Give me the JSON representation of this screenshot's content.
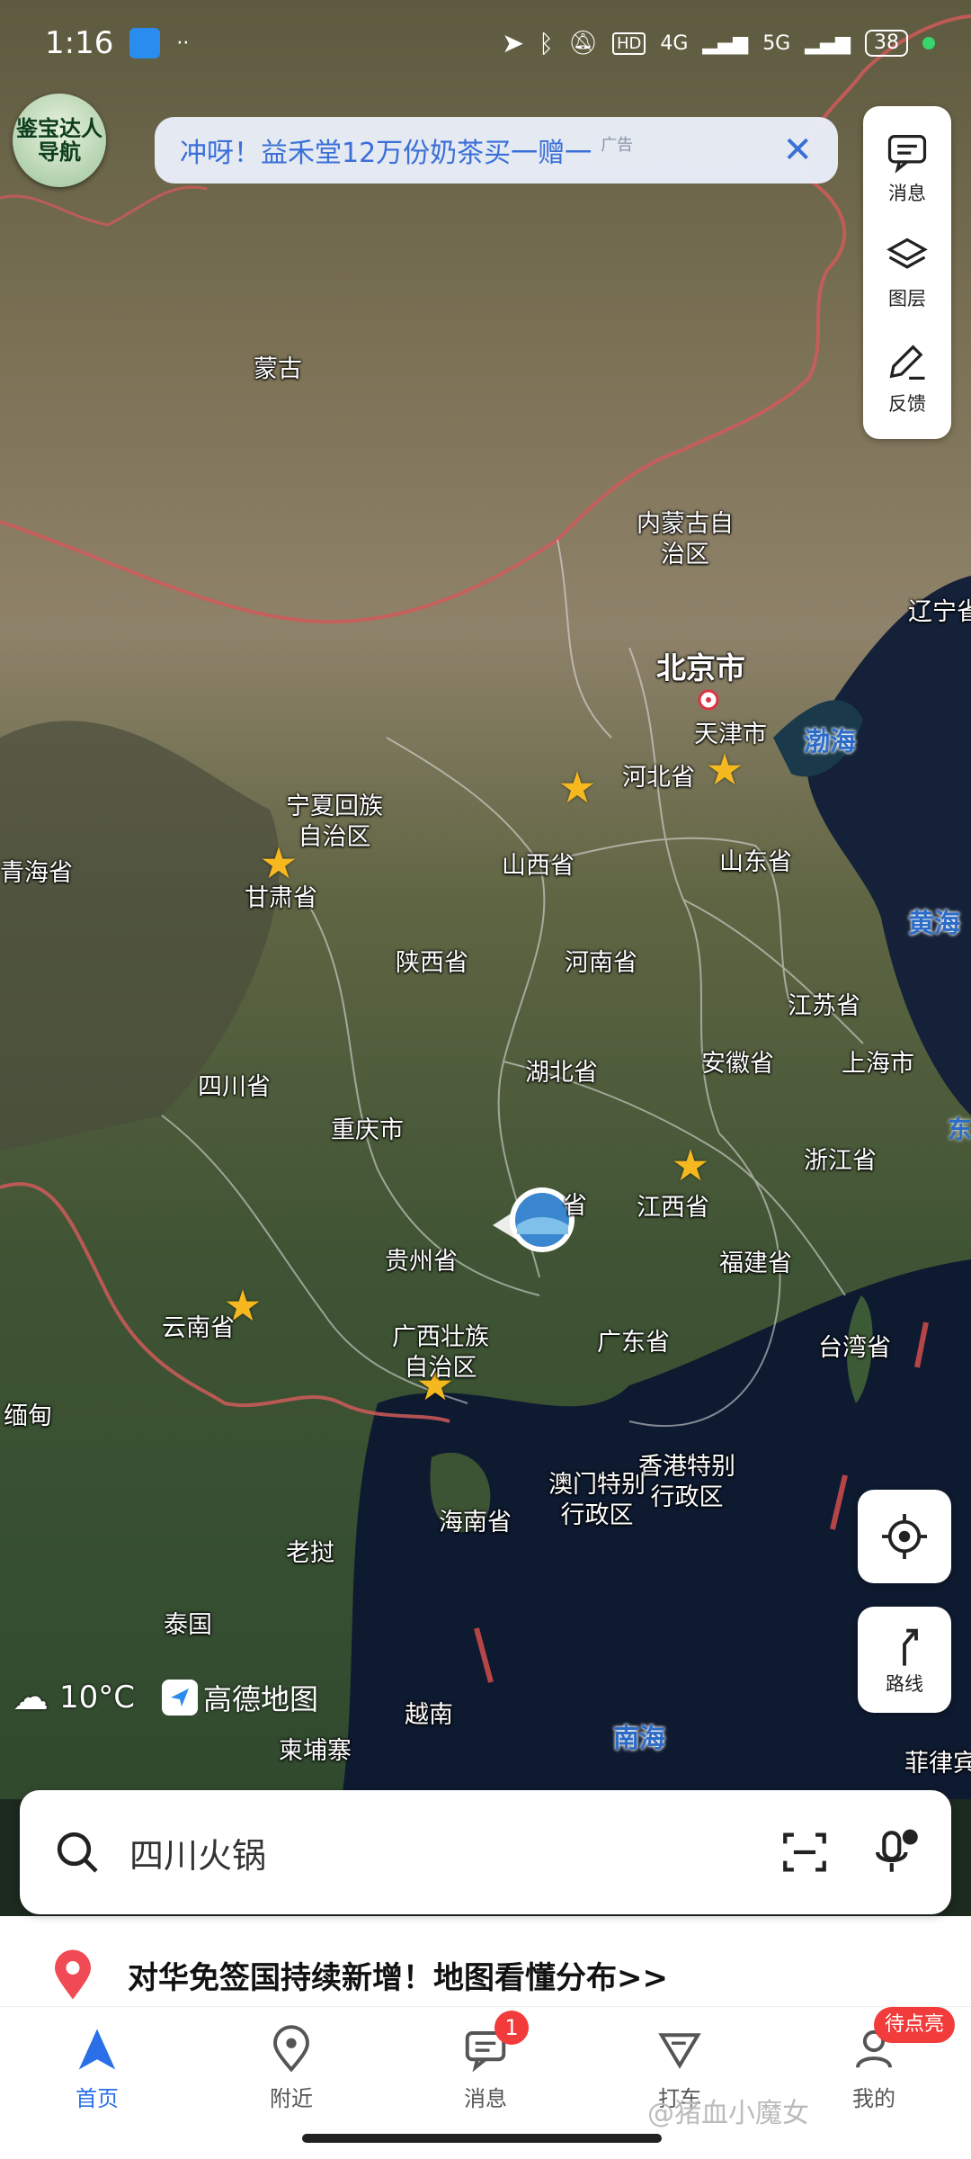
{
  "status_bar": {
    "time": "1:16",
    "network_4g": "4G",
    "network_5g": "5G",
    "battery": "38"
  },
  "top_badge": {
    "line1": "鉴宝达人",
    "line2": "导航"
  },
  "ad": {
    "text": "冲呀！益禾堂12万份奶茶买一赠一",
    "tag": "广告"
  },
  "side_panel": {
    "messages": "消息",
    "layers": "图层",
    "feedback": "反馈"
  },
  "route_label": "路线",
  "weather": {
    "temp": "10°C",
    "icon": "cloud-icon"
  },
  "brand": "高德地图",
  "map_labels": {
    "mongolia": "蒙古",
    "inner_mongolia_1": "内蒙古自",
    "inner_mongolia_2": "治区",
    "liaoning": "辽宁省",
    "beijing": "北京市",
    "tianjin": "天津市",
    "bohai": "渤海",
    "hebei": "河北省",
    "ningxia_1": "宁夏回族",
    "ningxia_2": "自治区",
    "qinghai": "青海省",
    "gansu": "甘肃省",
    "shanxi": "山西省",
    "shandong": "山东省",
    "yellow_sea": "黄海",
    "shaanxi": "陕西省",
    "henan": "河南省",
    "jiangsu": "江苏省",
    "sichuan": "四川省",
    "hubei": "湖北省",
    "anhui": "安徽省",
    "shanghai": "上海市",
    "chongqing": "重庆市",
    "zhejiang": "浙江省",
    "east_edge": "东",
    "hunan_partial": "省",
    "jiangxi": "江西省",
    "guizhou": "贵州省",
    "fujian": "福建省",
    "yunnan": "云南省",
    "guangxi_1": "广西壮族",
    "guangxi_2": "自治区",
    "guangdong": "广东省",
    "taiwan": "台湾省",
    "myanmar": "缅甸",
    "hongkong_1": "香港特别",
    "hongkong_2": "行政区",
    "macau_1": "澳门特别",
    "macau_2": "行政区",
    "hainan": "海南省",
    "laos": "老挝",
    "thailand": "泰国",
    "vietnam": "越南",
    "cambodia": "柬埔寨",
    "south_sea": "南海",
    "philippines": "菲律宾"
  },
  "search": {
    "placeholder": "四川火锅"
  },
  "notice": "对华免签国持续新增！地图看懂分布>>",
  "tabs": [
    {
      "label": "首页"
    },
    {
      "label": "附近"
    },
    {
      "label": "消息",
      "badge": "1"
    },
    {
      "label": "打车"
    },
    {
      "label": "我的",
      "pill": "待点亮"
    }
  ],
  "watermark": "@猪血小魔女",
  "colors": {
    "accent": "#2b6fe8",
    "badge": "#f23b3b",
    "star": "#f6b81f"
  }
}
